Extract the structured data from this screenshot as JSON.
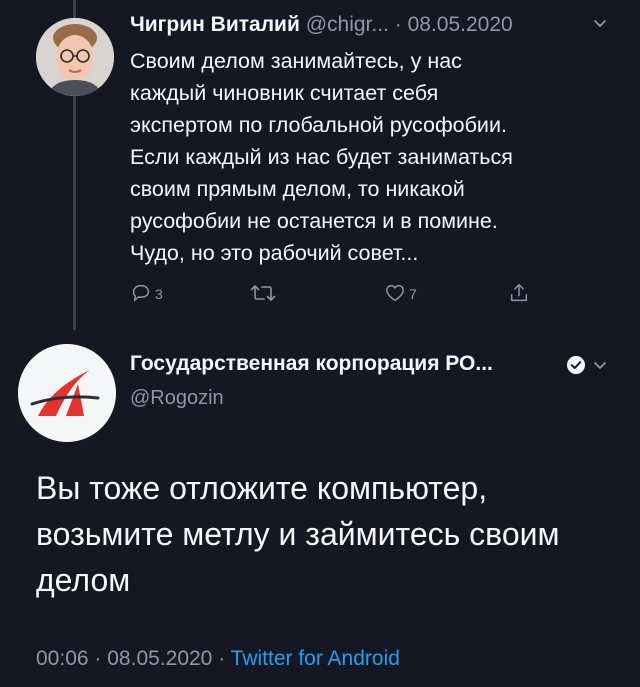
{
  "tweet1": {
    "author_name": "Чигрин Виталий",
    "handle": "@chigr...",
    "separator": "·",
    "date": "08.05.2020",
    "text_lines": [
      "Своим делом занимайтесь, у нас",
      "каждый чиновник считает себя",
      "экспертом по глобальной русофобии.",
      "Если каждый из нас будет заниматься",
      "своим прямым делом, то никакой",
      "русофобии не останется и в помине.",
      "Чудо, но это рабочий совет..."
    ],
    "actions": {
      "reply_count": "3",
      "retweet_count": "",
      "like_count": "7"
    },
    "icons": {
      "reply": "reply-icon",
      "retweet": "retweet-icon",
      "like": "like-icon",
      "share": "share-icon",
      "menu": "chevron-down-icon"
    }
  },
  "tweet2": {
    "author_name": "Государственная корпорация РО...",
    "handle": "@Rogozin",
    "verified": true,
    "text_lines": [
      "Вы тоже отложите компьютер,",
      "возьмите метлу и займитесь своим",
      "делом"
    ],
    "time": "00:06",
    "separator": "·",
    "date": "08.05.2020",
    "separator2": "·",
    "client": "Twitter for Android"
  },
  "colors": {
    "background": "#151823",
    "text": "#f5f7fa",
    "secondary": "#8b98a5",
    "accent": "#1da1f2",
    "logo_red": "#e5322d"
  }
}
